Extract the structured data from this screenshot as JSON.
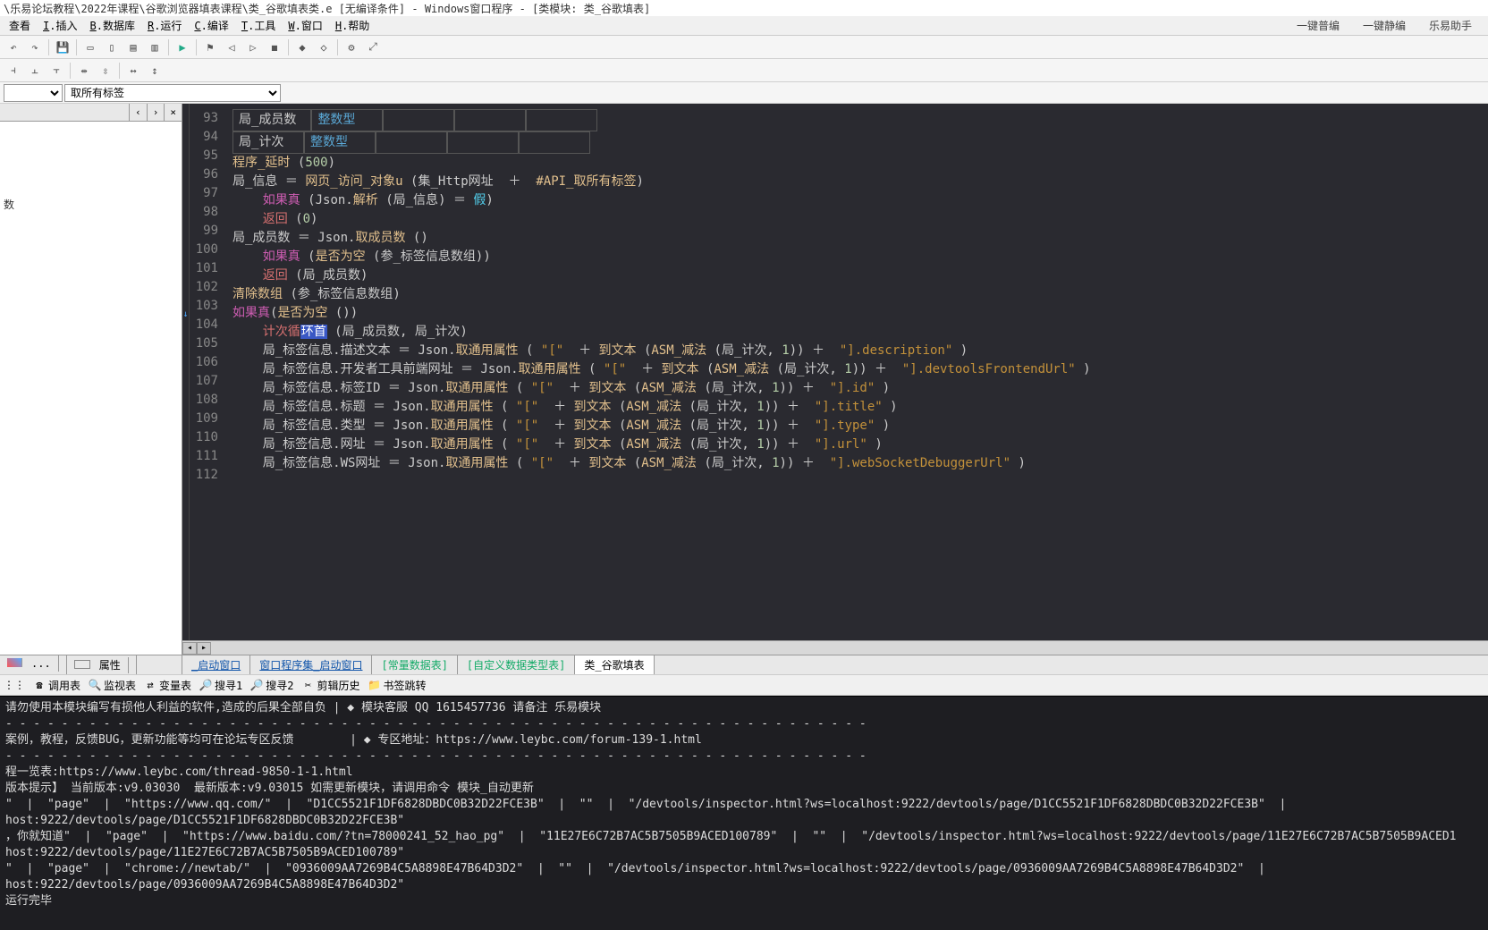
{
  "title": "\\乐易论坛教程\\2022年课程\\谷歌浏览器填表课程\\类_谷歌填表类.e [无编译条件] - Windows窗口程序 - [类模块: 类_谷歌填表]",
  "menu": [
    "查看",
    "插入",
    "数据库",
    "运行",
    "编译",
    "工具",
    "窗口",
    "帮助"
  ],
  "menu_keys": [
    "",
    "I",
    "B",
    "R",
    "C",
    "T",
    "W",
    "H"
  ],
  "menu_right": [
    "一键普编",
    "一键静编",
    "乐易助手"
  ],
  "dd1": "",
  "dd2": "取所有标签",
  "left_tabs": [
    "‹",
    "›",
    "×"
  ],
  "left_tree_item": "数",
  "left_bottom_tabs": [
    "...",
    "属性"
  ],
  "tabs": [
    "_启动窗口",
    "窗口程序集_启动窗口",
    "[常量数据表]",
    "[自定义数据类型表]",
    "类_谷歌填表"
  ],
  "tabs_active": 4,
  "search_bar": [
    "调用表",
    "监视表",
    "变量表",
    "搜寻1",
    "搜寻2",
    "剪辑历史",
    "书签跳转"
  ],
  "code_rows": [
    {
      "n": 93,
      "cells": [
        "局_成员数",
        "整数型"
      ]
    },
    {
      "n": 94,
      "cells": [
        "局_计次",
        "整数型"
      ]
    }
  ],
  "code_lines": [
    {
      "n": 95,
      "html": "<span class='fn'>程序_延时</span> <span class='op'>(</span><span class='num'>500</span><span class='op'>)</span>"
    },
    {
      "n": 96,
      "html": "<span class='var'>局_信息</span> <span class='op'>＝</span> <span class='fn'>网页_访问_对象u</span> <span class='op'>(</span><span class='var'>集_Http网址</span>  <span class='op'>＋</span>  <span class='fn'>#API_取所有标签</span><span class='op'>)</span>"
    },
    {
      "n": 97,
      "html": "    <span class='pink'>如果真</span> <span class='op'>(</span>Json.<span class='fn'>解析</span> <span class='op'>(</span>局_信息<span class='op'>)</span> <span class='op'>＝</span> <span class='kw'>假</span><span class='op'>)</span>"
    },
    {
      "n": 98,
      "html": "    <span class='red'>返回</span> <span class='op'>(</span><span class='num'>0</span><span class='op'>)</span>"
    },
    {
      "n": 99,
      "html": "<span class='var'>局_成员数</span> <span class='op'>＝</span> Json.<span class='fn'>取成员数</span> <span class='op'>()</span>"
    },
    {
      "n": 100,
      "html": "    <span class='pink'>如果真</span> <span class='op'>(</span><span class='fn'>是否为空</span> <span class='op'>(</span><span class='var'>参_标签信息数组</span><span class='op'>))</span>"
    },
    {
      "n": 101,
      "html": "    <span class='red'>返回</span> <span class='op'>(</span>局_成员数<span class='op'>)</span>"
    },
    {
      "n": 102,
      "html": "<span class='fn'>清除数组</span> <span class='op'>(</span><span class='var'>参_标签信息数组</span><span class='op'>)</span>"
    },
    {
      "n": 103,
      "html": "<span class='pink'>如果真</span><span class='op'>(</span><span class='fn'>是否为空</span> <span class='op'>())</span>"
    },
    {
      "n": 104,
      "html": "    <span class='red'>计次循<span class='hl'>环首</span></span> <span class='op'>(</span>局_成员数, 局_计次<span class='op'>)</span>"
    },
    {
      "n": 105,
      "html": "    局_标签信息.描述文本 <span class='op'>＝</span> Json.<span class='fn'>取通用属性</span> <span class='op'>(</span> <span class='str'>\"[\"</span>  <span class='op'>＋</span> <span class='fn'>到文本</span> <span class='op'>(</span><span class='fn'>ASM_减法</span> <span class='op'>(</span>局_计次, <span class='num'>1</span><span class='op'>))</span> <span class='op'>＋</span>  <span class='str'>\"].description\"</span> <span class='op'>)</span>"
    },
    {
      "n": 106,
      "html": "    局_标签信息.开发者工具前端网址 <span class='op'>＝</span> Json.<span class='fn'>取通用属性</span> <span class='op'>(</span> <span class='str'>\"[\"</span>  <span class='op'>＋</span> <span class='fn'>到文本</span> <span class='op'>(</span><span class='fn'>ASM_减法</span> <span class='op'>(</span>局_计次, <span class='num'>1</span><span class='op'>))</span> <span class='op'>＋</span>  <span class='str'>\"].devtoolsFrontendUrl\"</span> <span class='op'>)</span>"
    },
    {
      "n": 107,
      "html": "    局_标签信息.标签ID <span class='op'>＝</span> Json.<span class='fn'>取通用属性</span> <span class='op'>(</span> <span class='str'>\"[\"</span>  <span class='op'>＋</span> <span class='fn'>到文本</span> <span class='op'>(</span><span class='fn'>ASM_减法</span> <span class='op'>(</span>局_计次, <span class='num'>1</span><span class='op'>))</span> <span class='op'>＋</span>  <span class='str'>\"].id\"</span> <span class='op'>)</span>"
    },
    {
      "n": 108,
      "html": "    局_标签信息.标题 <span class='op'>＝</span> Json.<span class='fn'>取通用属性</span> <span class='op'>(</span> <span class='str'>\"[\"</span>  <span class='op'>＋</span> <span class='fn'>到文本</span> <span class='op'>(</span><span class='fn'>ASM_减法</span> <span class='op'>(</span>局_计次, <span class='num'>1</span><span class='op'>))</span> <span class='op'>＋</span>  <span class='str'>\"].title\"</span> <span class='op'>)</span>"
    },
    {
      "n": 109,
      "html": "    局_标签信息.类型 <span class='op'>＝</span> Json.<span class='fn'>取通用属性</span> <span class='op'>(</span> <span class='str'>\"[\"</span>  <span class='op'>＋</span> <span class='fn'>到文本</span> <span class='op'>(</span><span class='fn'>ASM_减法</span> <span class='op'>(</span>局_计次, <span class='num'>1</span><span class='op'>))</span> <span class='op'>＋</span>  <span class='str'>\"].type\"</span> <span class='op'>)</span>"
    },
    {
      "n": 110,
      "html": "    局_标签信息.网址 <span class='op'>＝</span> Json.<span class='fn'>取通用属性</span> <span class='op'>(</span> <span class='str'>\"[\"</span>  <span class='op'>＋</span> <span class='fn'>到文本</span> <span class='op'>(</span><span class='fn'>ASM_减法</span> <span class='op'>(</span>局_计次, <span class='num'>1</span><span class='op'>))</span> <span class='op'>＋</span>  <span class='str'>\"].url\"</span> <span class='op'>)</span>"
    },
    {
      "n": 111,
      "html": "    局_标签信息.WS网址 <span class='op'>＝</span> Json.<span class='fn'>取通用属性</span> <span class='op'>(</span> <span class='str'>\"[\"</span>  <span class='op'>＋</span> <span class='fn'>到文本</span> <span class='op'>(</span><span class='fn'>ASM_减法</span> <span class='op'>(</span>局_计次, <span class='num'>1</span><span class='op'>))</span> <span class='op'>＋</span>  <span class='str'>\"].webSocketDebuggerUrl\"</span> <span class='op'>)</span>"
    },
    {
      "n": 112,
      "html": ""
    }
  ],
  "console_lines": [
    "请勿使用本模块编写有损他人利益的软件,造成的后果全部自负 | ◆ 模块客服 QQ 1615457736 请备注 乐易模块",
    "- - - - - - - - - - - - - - - - - - - - - - - - - - - - - - - - - - - - - - - - - - - - - - - - - - - - - - - - - - - - - -",
    "案例，教程，反馈BUG，更新功能等均可在论坛专区反馈        | ◆ 专区地址：https://www.leybc.com/forum-139-1.html",
    "- - - - - - - - - - - - - - - - - - - - - - - - - - - - - - - - - - - - - - - - - - - - - - - - - - - - - - - - - - - - - -",
    "程一览表:https://www.leybc.com/thread-9850-1-1.html",
    "",
    "版本提示】 当前版本:v9.03030  最新版本:v9.03015 如需更新模块，请调用命令 模块_自动更新",
    "\"  |  \"page\"  |  \"https://www.qq.com/\"  |  \"D1CC5521F1DF6828DBDC0B32D22FCE3B\"  |  \"\"  |  \"/devtools/inspector.html?ws=localhost:9222/devtools/page/D1CC5521F1DF6828DBDC0B32D22FCE3B\"  |  ",
    "host:9222/devtools/page/D1CC5521F1DF6828DBDC0B32D22FCE3B\"",
    "，你就知道\"  |  \"page\"  |  \"https://www.baidu.com/?tn=78000241_52_hao_pg\"  |  \"11E27E6C72B7AC5B7505B9ACED100789\"  |  \"\"  |  \"/devtools/inspector.html?ws=localhost:9222/devtools/page/11E27E6C72B7AC5B7505B9ACED1",
    "host:9222/devtools/page/11E27E6C72B7AC5B7505B9ACED100789\"",
    "\"  |  \"page\"  |  \"chrome://newtab/\"  |  \"0936009AA7269B4C5A8898E47B64D3D2\"  |  \"\"  |  \"/devtools/inspector.html?ws=localhost:9222/devtools/page/0936009AA7269B4C5A8898E47B64D3D2\"  |  ",
    "host:9222/devtools/page/0936009AA7269B4C5A8898E47B64D3D2\"",
    "运行完毕"
  ]
}
